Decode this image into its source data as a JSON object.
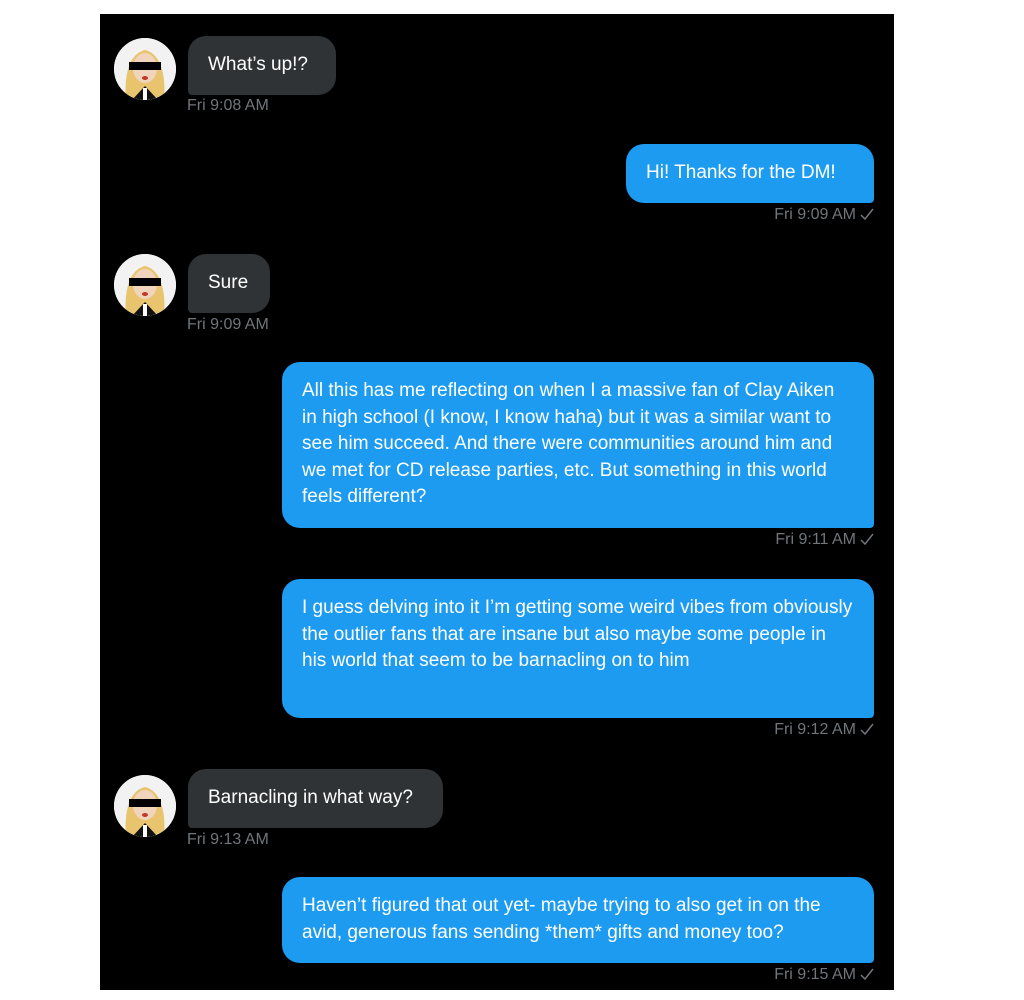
{
  "conversation": {
    "messages": [
      {
        "direction": "in",
        "text": "What’s up!?",
        "time": "Fri 9:08 AM"
      },
      {
        "direction": "out",
        "text": "Hi! Thanks for the DM!",
        "time": "Fri 9:09 AM",
        "status_icon": "check-icon"
      },
      {
        "direction": "in",
        "text": "Sure",
        "time": "Fri 9:09 AM"
      },
      {
        "direction": "out",
        "text": "All this has me reflecting on when I a massive fan of Clay Aiken in high school (I know, I know haha) but it was a similar want to see him succeed. And there were communities around him and we met for CD release parties, etc. But something in this world feels different?",
        "time": "Fri 9:11 AM",
        "status_icon": "check-icon"
      },
      {
        "direction": "out",
        "text": "I guess delving into it I’m getting some weird vibes from obviously the outlier fans that are insane but also maybe some people in his world that seem to be barnacling on to him",
        "time": "Fri 9:12 AM",
        "status_icon": "check-icon"
      },
      {
        "direction": "in",
        "text": "Barnacling in what way?",
        "time": "Fri 9:13 AM"
      },
      {
        "direction": "out",
        "text": "Haven’t figured that out yet- maybe trying to also get in on the avid, generous fans sending *them* gifts and money too?",
        "time": "Fri 9:15 AM",
        "status_icon": "check-icon"
      }
    ]
  },
  "colors": {
    "background": "#000000",
    "incoming_bubble": "#2f3336",
    "outgoing_bubble": "#1d9bf0",
    "timestamp": "#71767b"
  }
}
